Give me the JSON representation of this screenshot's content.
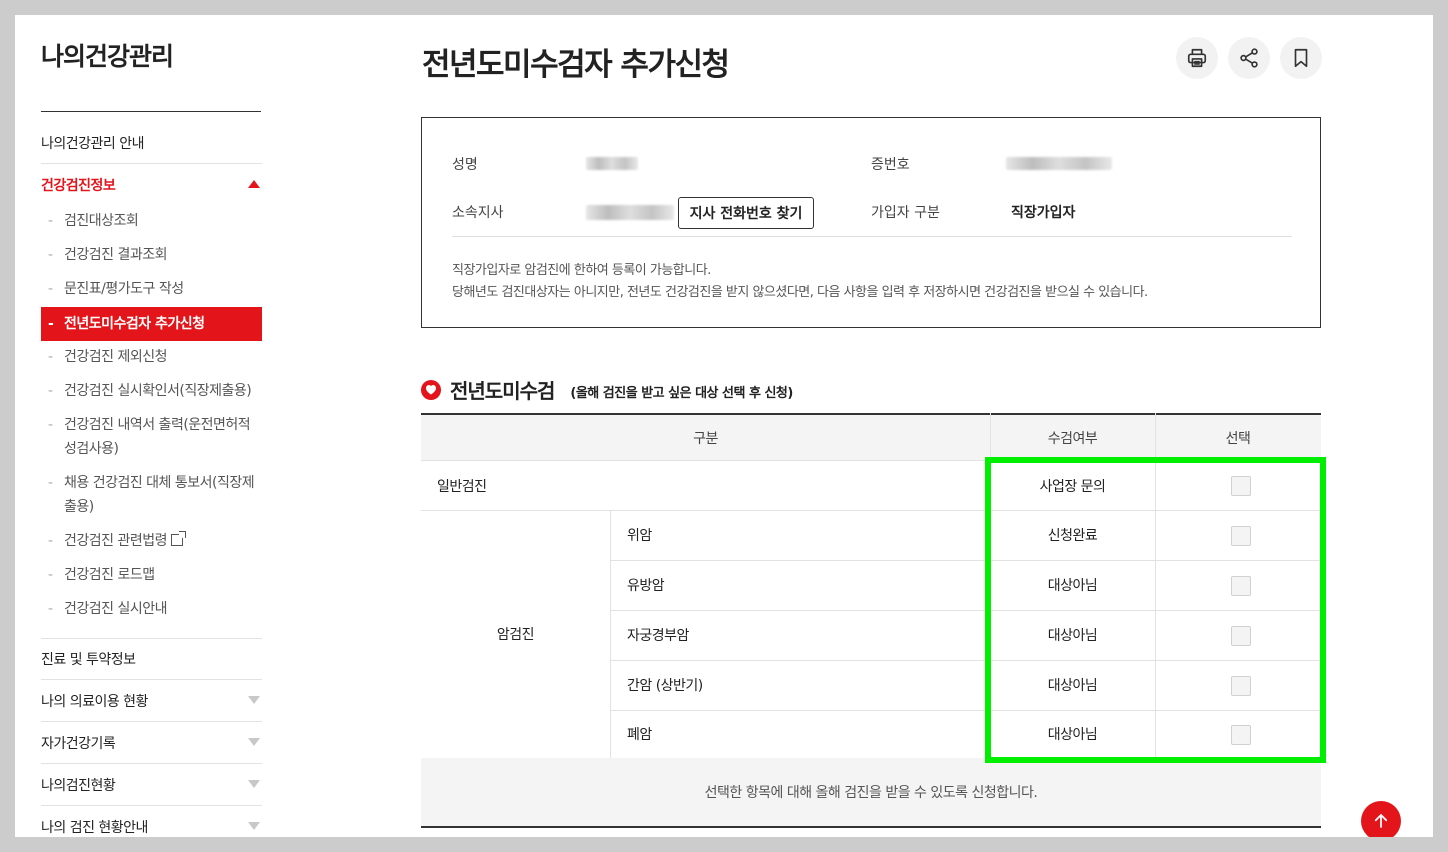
{
  "sidebar": {
    "title": "나의건강관리",
    "items": [
      {
        "label": "나의건강관리 안내"
      },
      {
        "label": "건강검진정보"
      },
      {
        "label": "진료 및 투약정보"
      },
      {
        "label": "나의 의료이용 현황"
      },
      {
        "label": "자가건강기록"
      },
      {
        "label": "나의검진현황"
      },
      {
        "label": "나의 검진 현황안내"
      }
    ],
    "subs": [
      {
        "label": "검진대상조회"
      },
      {
        "label": "건강검진 결과조회"
      },
      {
        "label": "문진표/평가도구 작성"
      },
      {
        "label": "전년도미수검자 추가신청"
      },
      {
        "label": "건강검진 제외신청"
      },
      {
        "label": "건강검진 실시확인서(직장제출용)"
      },
      {
        "label": "건강검진 내역서 출력(운전면허적성검사용)"
      },
      {
        "label": "채용 건강검진 대체 통보서(직장제출용)"
      },
      {
        "label": "건강검진 관련법령"
      },
      {
        "label": "건강검진 로드맵"
      },
      {
        "label": "건강검진 실시안내"
      }
    ]
  },
  "page": {
    "title": "전년도미수검자 추가신청"
  },
  "info": {
    "name_label": "성명",
    "id_label": "증번호",
    "branch_label": "소속지사",
    "find_button": "지사 전화번호 찾기",
    "type_label": "가입자 구분",
    "type_value": "직장가입자",
    "note1": "직장가입자로 암검진에 한하여 등록이 가능합니다.",
    "note2": "당해년도 검진대상자는 아니지만, 전년도 건강검진을 받지 않으셨다면, 다음 사항을 입력 후 저장하시면 건강검진을 받으실 수 있습니다."
  },
  "section": {
    "title": "전년도미수검",
    "subtitle": "(올해 검진을 받고 싶은 대상 선택 후 신청)"
  },
  "table": {
    "headers": [
      "구분",
      "수검여부",
      "선택"
    ],
    "general": {
      "label": "일반검진",
      "status": "사업장 문의"
    },
    "cancer_group": "암검진",
    "cancer_rows": [
      {
        "label": "위암",
        "status": "신청완료"
      },
      {
        "label": "유방암",
        "status": "대상아님"
      },
      {
        "label": "자궁경부암",
        "status": "대상아님"
      },
      {
        "label": "간암 (상반기)",
        "status": "대상아님"
      },
      {
        "label": "폐암",
        "status": "대상아님"
      }
    ],
    "footer": "선택한 항목에 대해 올해 검진을 받을 수 있도록 신청합니다."
  },
  "colors": {
    "accent": "#e3141a",
    "highlight": "#00ee00"
  }
}
